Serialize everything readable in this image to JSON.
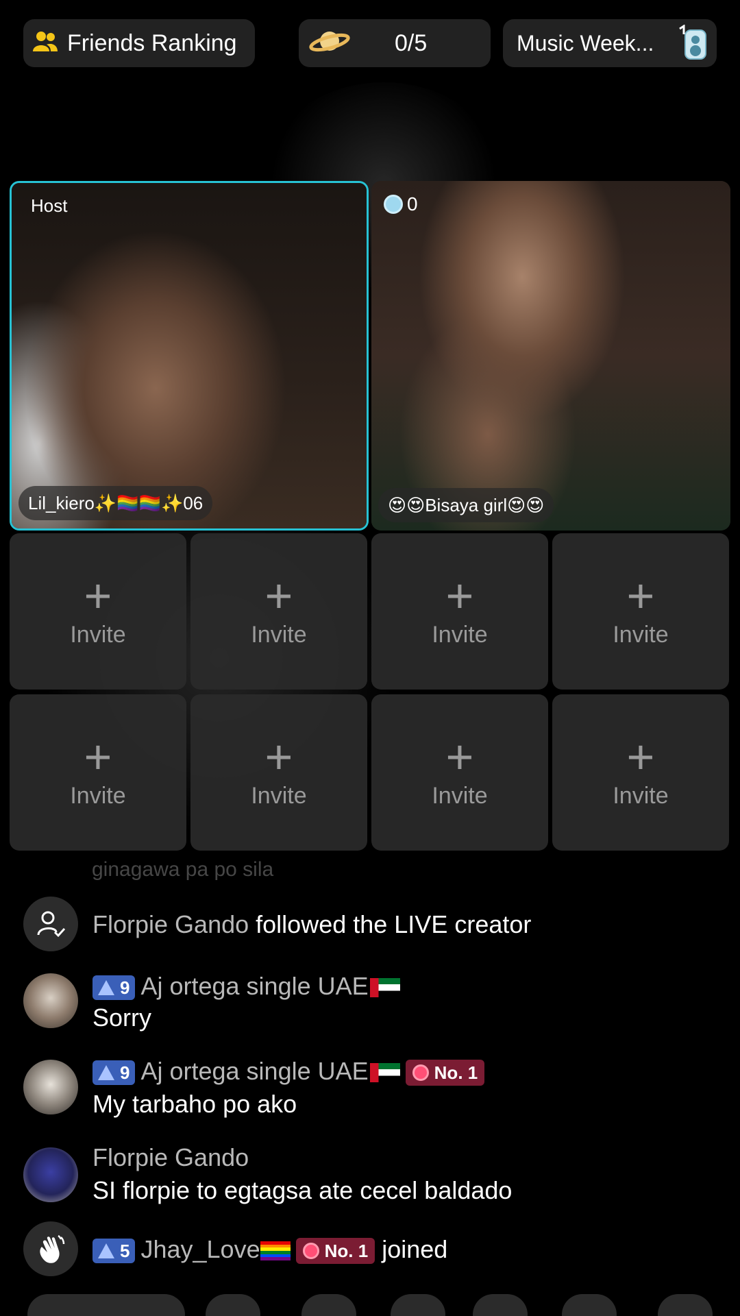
{
  "top_bar": {
    "friends_ranking": "Friends Ranking",
    "goal_count": "0/5",
    "music_week": "Music Week..."
  },
  "tiles": {
    "host": {
      "tag": "Host",
      "name": "Lil_kiero✨🏳️‍🌈🏳️‍🌈✨06"
    },
    "guest": {
      "coins": "0",
      "name": "😍😍Bisaya girl😍😍"
    }
  },
  "invite": {
    "label": "Invite",
    "plus": "+"
  },
  "chat": {
    "faded_line": "ginagawa pa po sila",
    "messages": [
      {
        "user": "Florpie Gando",
        "text": "followed the LIVE creator"
      },
      {
        "level": "9",
        "user": "Aj ortega single UAE",
        "text": "Sorry"
      },
      {
        "level": "9",
        "user": "Aj ortega single UAE",
        "rank": "No. 1",
        "text": "My tarbaho po ako"
      },
      {
        "user": "Florpie Gando",
        "text": "SI florpie to egtagsa ate cecel baldado"
      },
      {
        "level": "5",
        "user": "Jhay_Love",
        "rank": "No. 1",
        "text": "joined"
      }
    ]
  },
  "colors": {
    "host_border": "#27c2d4",
    "level_badge": "#3a5fb8",
    "rank_badge": "#7b1c33"
  },
  "icons": [
    "friends-icon",
    "planet-icon",
    "music-speaker-icon",
    "follow-user-icon",
    "wave-hand-icon",
    "coin-icon"
  ]
}
